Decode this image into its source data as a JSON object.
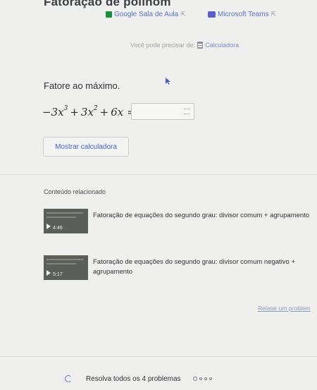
{
  "page": {
    "title_fragment": "Fatoração de polinôm"
  },
  "links": {
    "google_classroom": "Google Sala de Aula",
    "microsoft_teams": "Microsoft Teams"
  },
  "calculator_note": {
    "prefix": "Você pode precisar de:",
    "link": "Calculadora"
  },
  "question": {
    "prompt": "Fatore ao máximo.",
    "answer_value": ""
  },
  "buttons": {
    "show_calculator": "Mostrar calculadora"
  },
  "related": {
    "heading": "Conteúdo relacionado",
    "videos": [
      {
        "title": "Fatoração de equações do segundo grau: divisor comum + agrupamento",
        "duration": "4:46"
      },
      {
        "title": "Fatoração de equações do segundo grau: divisor comum negativo + agrupamento",
        "duration": "5:17"
      }
    ]
  },
  "report_link": "Relatar um problem",
  "footer": {
    "solve_all": "Resolva todos os 4 problemas",
    "progress_total": 4,
    "progress_done": 0
  },
  "colors": {
    "link": "#5a73c7",
    "classroom_green": "#1e8e3e",
    "teams_purple": "#5b5fc7",
    "background": "#efefed"
  },
  "icons": [
    "google-classroom-icon",
    "external-link-icon",
    "teams-icon",
    "calculator-icon",
    "cursor-icon",
    "keyboard-icon",
    "play-icon",
    "refresh-icon"
  ]
}
